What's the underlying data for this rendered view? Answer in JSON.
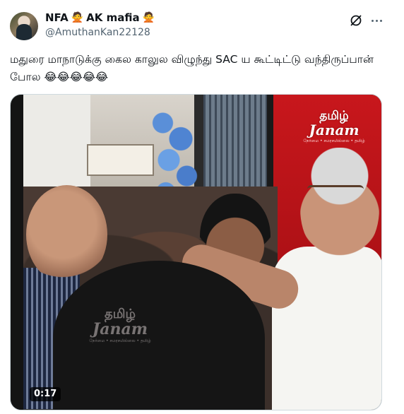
{
  "author": {
    "display_name": "NFA",
    "emoji_1": "🙅",
    "name_suffix": "AK mafia",
    "emoji_2": "🙅",
    "handle": "@AmuthanKan22128"
  },
  "tweet": {
    "text": "மதுரை மாநாடுக்கு கைல காலுல விழுந்து SAC ய கூட்டிட்டு வந்திருப்பான் போல 😂😂😂😂😂"
  },
  "media": {
    "type": "video",
    "duration": "0:17",
    "watermark": {
      "line1": "தமிழ்",
      "line2": "Janam",
      "line3": "நேர்மை • சமரசமில்லை • தமிழ்"
    }
  },
  "icons": {
    "grok": "grok-icon",
    "more": "more-icon"
  },
  "colors": {
    "text": "#0f1419",
    "secondary": "#536471",
    "border": "#cfd9de"
  }
}
